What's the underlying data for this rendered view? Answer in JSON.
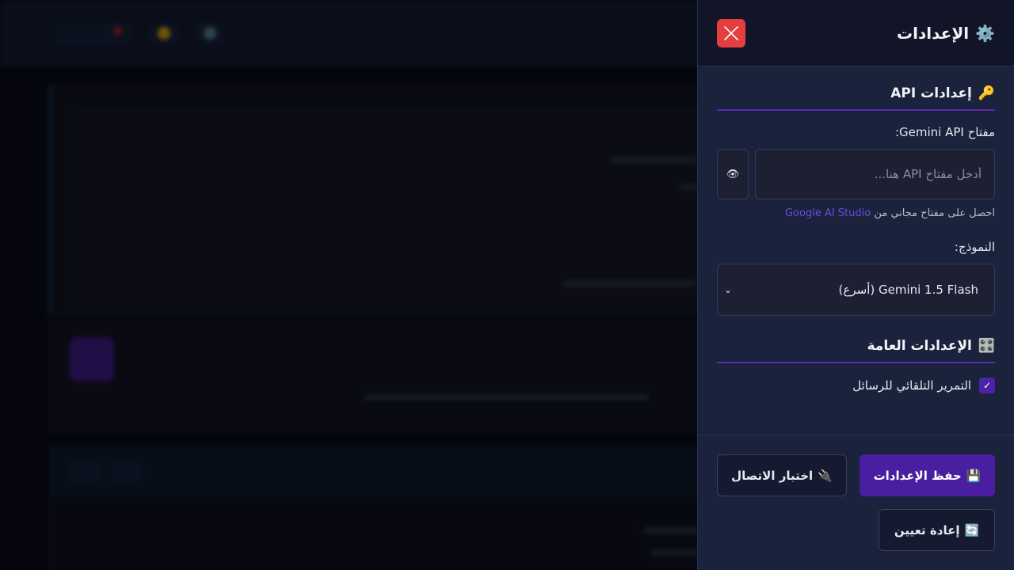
{
  "panel": {
    "title": "الإعدادات",
    "title_icon": "⚙️",
    "close_icon": "close-icon"
  },
  "api_section": {
    "title": "إعدادات API",
    "icon": "🔑",
    "key_label": "مفتاح Gemini API:",
    "key_placeholder": "أدخل مفتاح API هنا...",
    "key_value": "",
    "toggle_icon": "👁",
    "hint_text": "احصل على مفتاح مجاني من",
    "hint_link": "Google AI Studio",
    "model_label": "النموذج:",
    "model_selected": "Gemini 1.5 Flash (أسرع)"
  },
  "general_section": {
    "title": "الإعدادات العامة",
    "icon": "🎛️",
    "auto_scroll_label": "التمرير التلقائي للرسائل",
    "auto_scroll_checked": true
  },
  "footer": {
    "save_label": "حفظ الإعدادات",
    "save_icon": "💾",
    "test_label": "اختبار الاتصال",
    "test_icon": "🔌",
    "reset_label": "إعادة تعيين",
    "reset_icon": "🔄"
  },
  "colors": {
    "accent": "#4a1ea0",
    "close": "#e53e3e",
    "link": "#6b4de0"
  }
}
